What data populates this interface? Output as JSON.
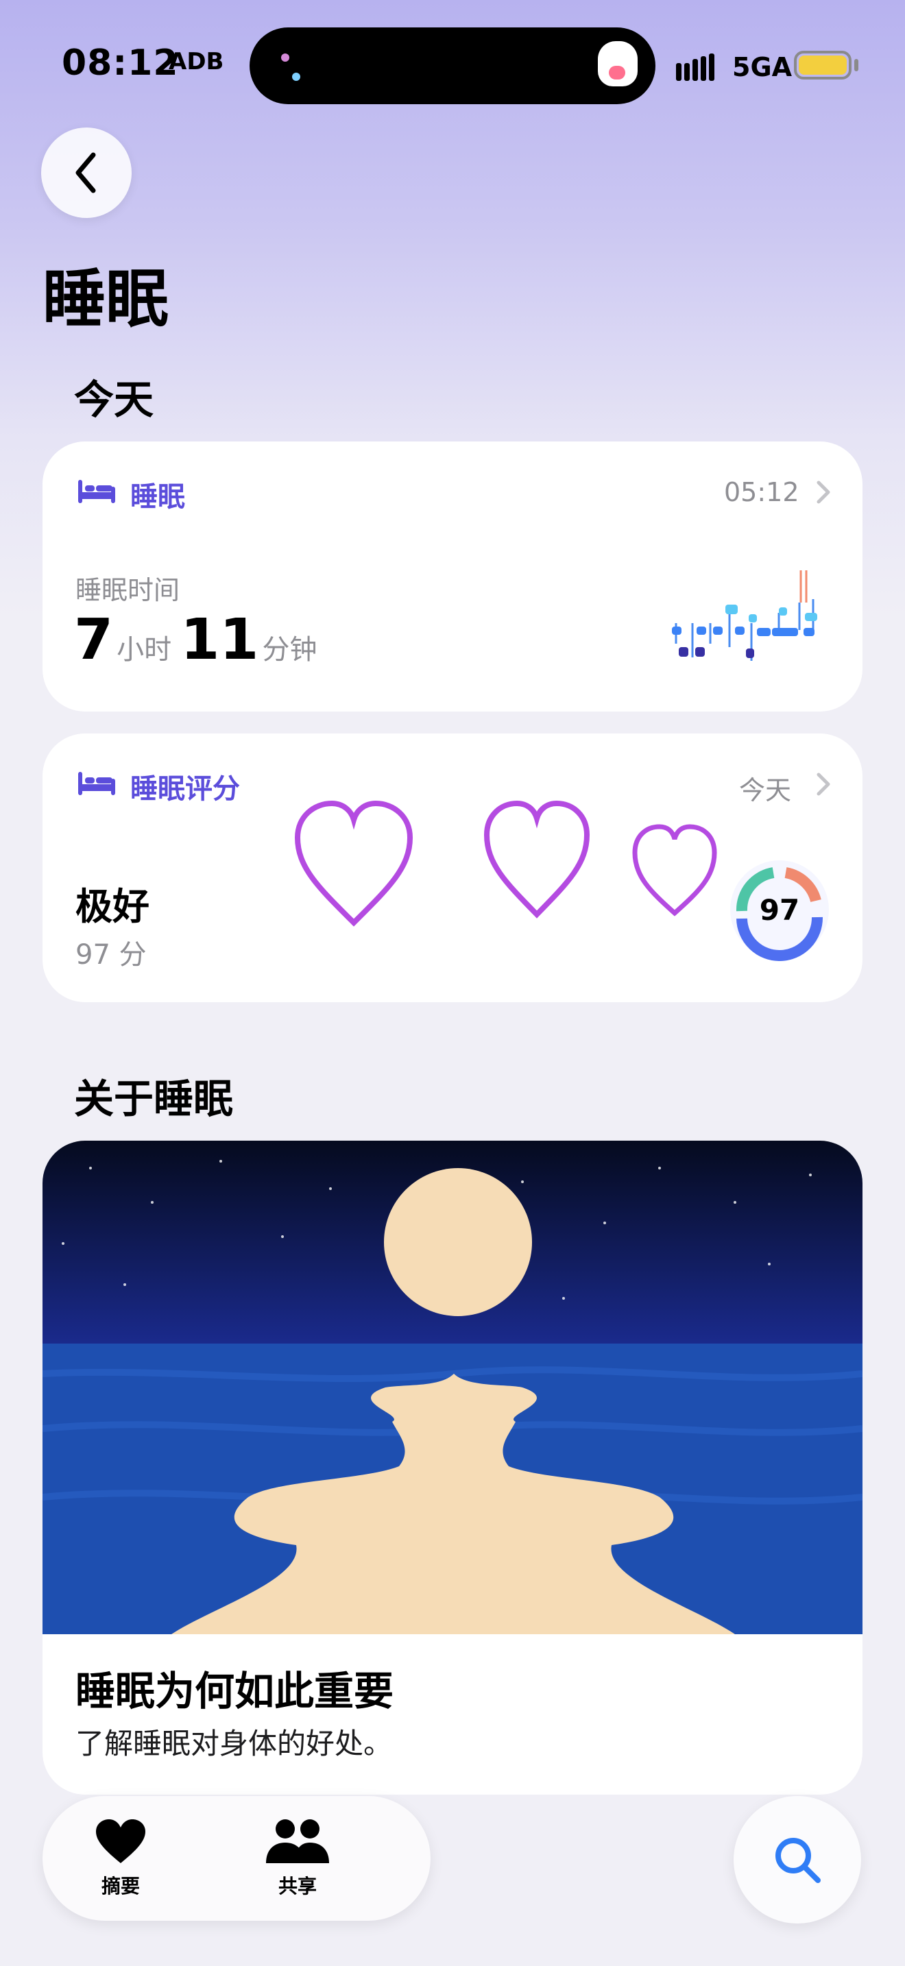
{
  "status_bar": {
    "time": "08:12",
    "glyph": "ADB",
    "network": "5GA",
    "battery_level": 0.85,
    "battery_color": "#f3cf3e"
  },
  "header": {
    "title": "睡眠"
  },
  "today": {
    "section_title": "今天",
    "sleep_card": {
      "label": "睡眠",
      "time": "05:12",
      "metric_label": "睡眠时间",
      "hours": "7",
      "hours_unit": "小时",
      "minutes": "11",
      "minutes_unit": "分钟"
    },
    "score_card": {
      "label": "睡眠评分",
      "meta": "今天",
      "rating": "极好",
      "score_text": "97 分",
      "ring_value": "97",
      "ring_fraction": 0.97
    }
  },
  "about": {
    "section_title": "关于睡眠",
    "article_title": "睡眠为何如此重要",
    "article_subtitle": "了解睡眠对身体的好处。"
  },
  "tab_bar": {
    "tabs": [
      {
        "label": "摘要",
        "icon": "heart-icon"
      },
      {
        "label": "共享",
        "icon": "people-icon"
      }
    ],
    "search_icon": "search-icon"
  },
  "colors": {
    "accent": "#5b4ddb",
    "heart_outline": "#b44be1",
    "search_blue": "#2f7df6"
  }
}
